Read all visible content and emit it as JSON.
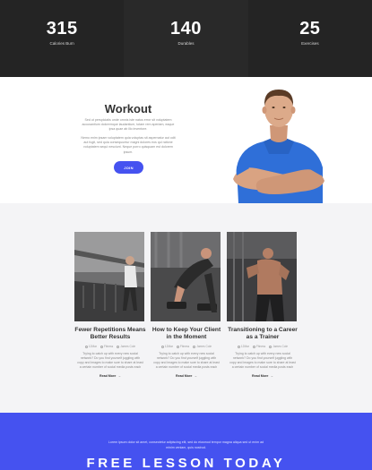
{
  "stats": [
    {
      "value": "315",
      "label": "Calories Burn"
    },
    {
      "value": "140",
      "label": "Durables"
    },
    {
      "value": "25",
      "label": "Exercises"
    }
  ],
  "workout": {
    "title": "Workout",
    "paragraph_1": "Sed ut perspiciatis unde omnis iste natus error sit voluptatem accusantium doloremque laudantium, totam rem aperiam, eaque ipsa quae ab illo inventore.",
    "paragraph_2": "Nemo enim ipsam voluptatem quia voluptas sit aspernatur aut odit aut fugit, sed quia consequuntur magni dolores eos qui ratione voluptatem sequi nesciunt. Neque porro quisquam est dolorem ipsum.",
    "button": "JOIN"
  },
  "cards": [
    {
      "title": "Fewer Repetitions Means Better Results",
      "meta": [
        "12Mar",
        "Fitness",
        "James Cole"
      ],
      "text": "Trying to catch up with every new social network? Do you find yourself juggling with copy and images to make sure to share at least a certain number of social media posts each",
      "read_more": "Read More"
    },
    {
      "title": "How to Keep Your Client in the Moment",
      "meta": [
        "12Mar",
        "Fitness",
        "James Cole"
      ],
      "text": "Trying to catch up with every new social network? Do you find yourself juggling with copy and images to make sure to share at least a certain number of social media posts each",
      "read_more": "Read More"
    },
    {
      "title": "Transitioning to a Career as a Trainer",
      "meta": [
        "12Mar",
        "Fitness",
        "James Cole"
      ],
      "text": "Trying to catch up with every new social network? Do you find yourself juggling with copy and images to make sure to share at least a certain number of social media posts each",
      "read_more": "Read More"
    }
  ],
  "cta": {
    "text": "Lorem ipsum dolor sit amet, consectetur adipiscing elit, sed do eiusmod tempor magna aliqua sed ut enim ad minim veniam, quis nostrud.",
    "title": "FREE LESSON TODAY"
  },
  "colors": {
    "accent": "#4552f0",
    "dark_band": "#242424",
    "blog_bg": "#f4f4f6"
  }
}
